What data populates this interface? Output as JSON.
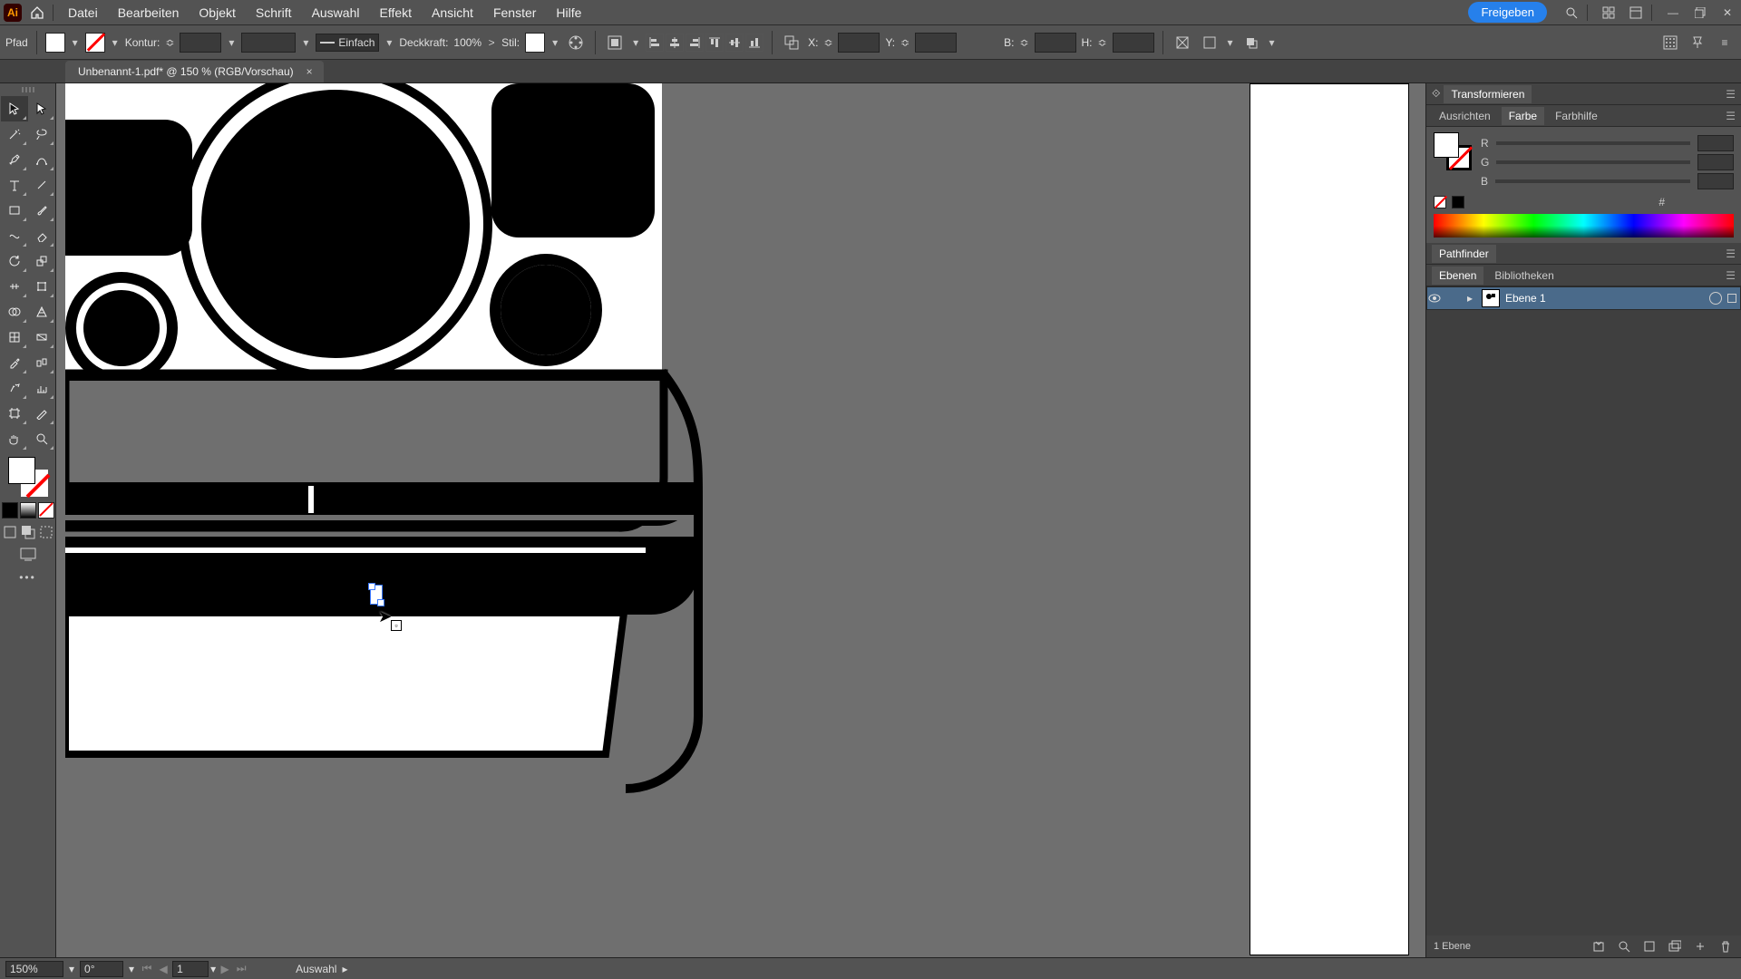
{
  "app": {
    "abbr": "Ai"
  },
  "menu": [
    "Datei",
    "Bearbeiten",
    "Objekt",
    "Schrift",
    "Auswahl",
    "Effekt",
    "Ansicht",
    "Fenster",
    "Hilfe"
  ],
  "share_label": "Freigeben",
  "optbar": {
    "mode": "Pfad",
    "stroke_label": "Kontur:",
    "stroke_style": "Einfach",
    "opacity_label": "Deckkraft:",
    "opacity_value": "100%",
    "style_label": "Stil:",
    "x_label": "X:",
    "y_label": "Y:",
    "w_label": "B:",
    "h_label": "H:"
  },
  "tab": {
    "title": "Unbenannt-1.pdf* @ 150 % (RGB/Vorschau)"
  },
  "panels": {
    "transform": "Transformieren",
    "align": "Ausrichten",
    "color": "Farbe",
    "color_guide": "Farbhilfe",
    "pathfinder": "Pathfinder",
    "layers": "Ebenen",
    "libraries": "Bibliotheken",
    "rgb": {
      "r": "R",
      "g": "G",
      "b": "B"
    },
    "hex": "#"
  },
  "layers": {
    "items": [
      {
        "name": "Ebene 1"
      }
    ],
    "count_label": "1 Ebene"
  },
  "status": {
    "zoom": "150%",
    "rotate": "0°",
    "artboard": "1",
    "tool": "Auswahl"
  }
}
